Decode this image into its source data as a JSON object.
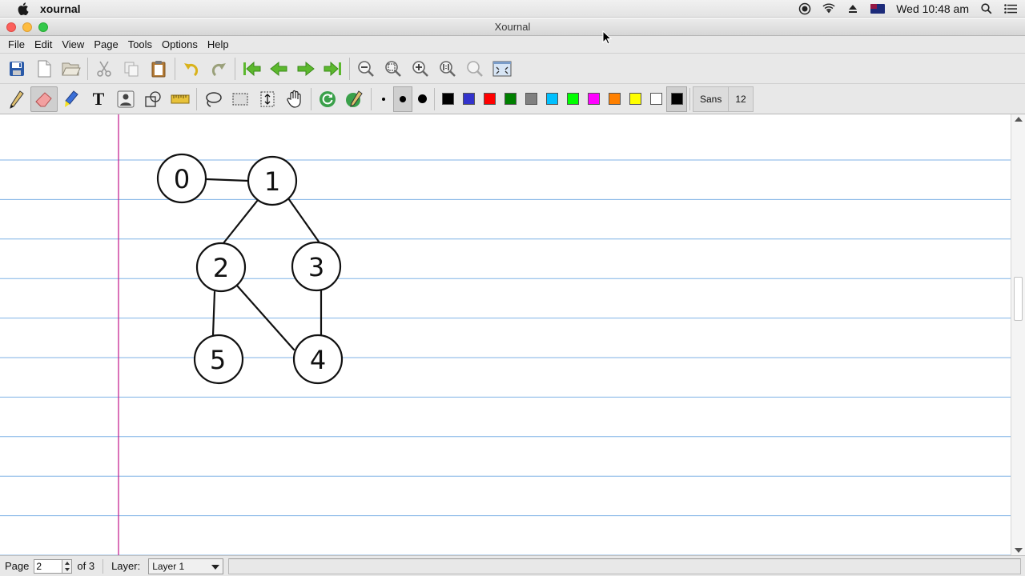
{
  "menubar": {
    "app_name": "xournal",
    "clock": "Wed 10:48 am"
  },
  "window": {
    "title": "Xournal"
  },
  "app_menu": [
    "File",
    "Edit",
    "View",
    "Page",
    "Tools",
    "Options",
    "Help"
  ],
  "toolbar_text": {
    "text_tool": "T",
    "font_name": "Sans",
    "font_size": "12"
  },
  "colors": {
    "palette": [
      "#000000",
      "#3333cc",
      "#ff0000",
      "#008000",
      "#808080",
      "#00c0ff",
      "#00ff00",
      "#ff00ff",
      "#ff8000",
      "#ffff00",
      "#ffffff",
      "#000000"
    ],
    "ruling": "#7fb2e6",
    "margin": "#c2148a"
  },
  "graph": {
    "nodes": [
      {
        "label": "0"
      },
      {
        "label": "1"
      },
      {
        "label": "2"
      },
      {
        "label": "3"
      },
      {
        "label": "5"
      },
      {
        "label": "4"
      }
    ]
  },
  "status": {
    "page_label": "Page",
    "page_value": "2",
    "page_of": "of 3",
    "layer_label": "Layer:",
    "layer_value": "Layer 1"
  }
}
